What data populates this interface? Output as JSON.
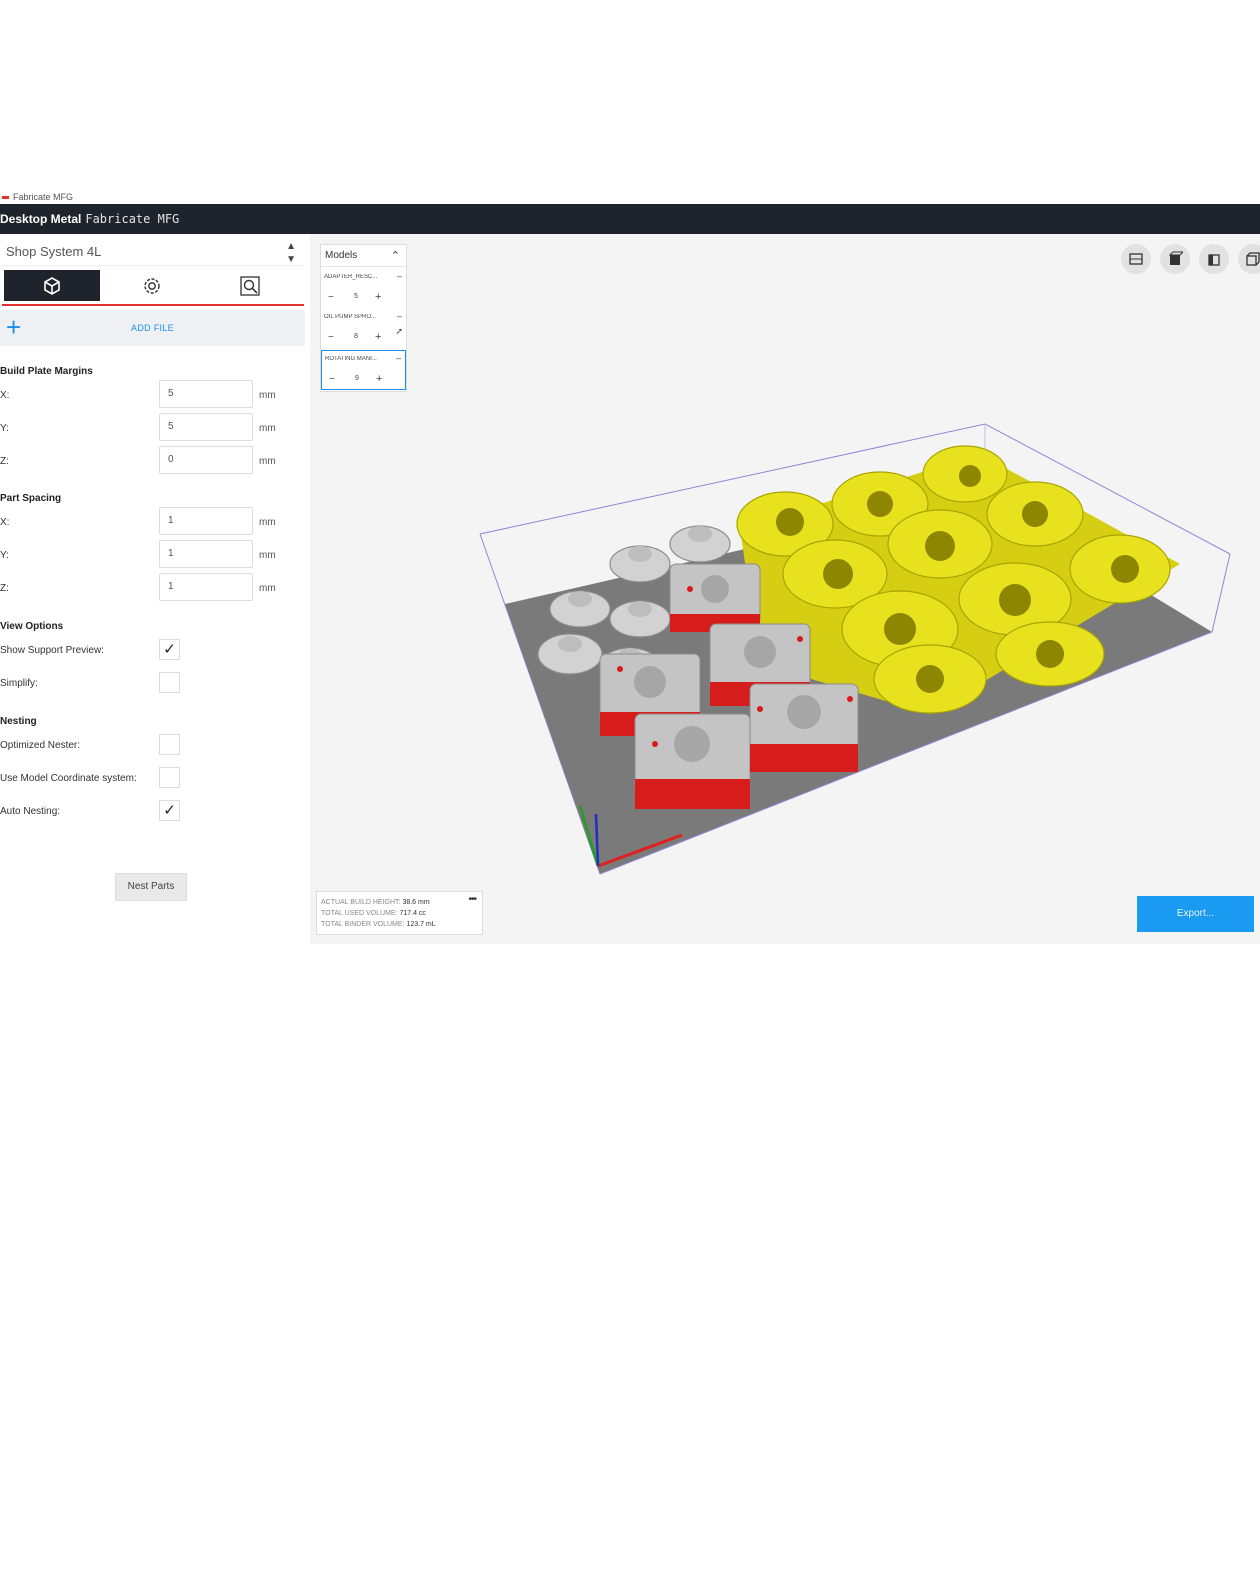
{
  "window": {
    "os_title": "Fabricate MFG",
    "brand": "Desktop Metal",
    "product": "Fabricate MFG"
  },
  "sidebar": {
    "printer": "Shop System 4L",
    "add_file_label": "ADD FILE",
    "build_plate_margins": {
      "title": "Build Plate Margins",
      "fields": [
        {
          "label": "X:",
          "value": "5",
          "unit": "mm"
        },
        {
          "label": "Y:",
          "value": "5",
          "unit": "mm"
        },
        {
          "label": "Z:",
          "value": "0",
          "unit": "mm"
        }
      ]
    },
    "part_spacing": {
      "title": "Part Spacing",
      "fields": [
        {
          "label": "X:",
          "value": "1",
          "unit": "mm"
        },
        {
          "label": "Y:",
          "value": "1",
          "unit": "mm"
        },
        {
          "label": "Z:",
          "value": "1",
          "unit": "mm"
        }
      ]
    },
    "view_options": {
      "title": "View Options",
      "show_support_preview": {
        "label": "Show Support Preview:",
        "checked": true
      },
      "simplify": {
        "label": "Simplify:",
        "checked": false
      }
    },
    "nesting": {
      "title": "Nesting",
      "optimized_nester": {
        "label": "Optimized Nester:",
        "checked": false
      },
      "use_model_coordinate_system": {
        "label": "Use Model Coordinate system:",
        "checked": false
      },
      "auto_nesting": {
        "label": "Auto Nesting:",
        "checked": true
      },
      "nest_parts_label": "Nest Parts"
    }
  },
  "models_panel": {
    "title": "Models",
    "items": [
      {
        "name": "ADAPTER_RESC...",
        "qty": "5"
      },
      {
        "name": "OIL PUMP SPRO...",
        "qty": "8"
      },
      {
        "name": "ROTATING MANI...",
        "qty": "9"
      }
    ]
  },
  "stats": {
    "build_height_label": "ACTUAL BUILD HEIGHT:",
    "build_height_value": "38.6 mm",
    "used_volume_label": "TOTAL USED VOLUME:",
    "used_volume_value": "717.4 cc",
    "binder_volume_label": "TOTAL BINDER VOLUME:",
    "binder_volume_value": "123.7 mL"
  },
  "export_label": "Export...",
  "colors": {
    "header_bg": "#1f232b",
    "accent_red": "#e0312b",
    "accent_blue": "#1a9af0",
    "part_yellow": "#e8e21e",
    "part_gray": "#c9c9c9",
    "plate_gray": "#7a7a7a"
  }
}
